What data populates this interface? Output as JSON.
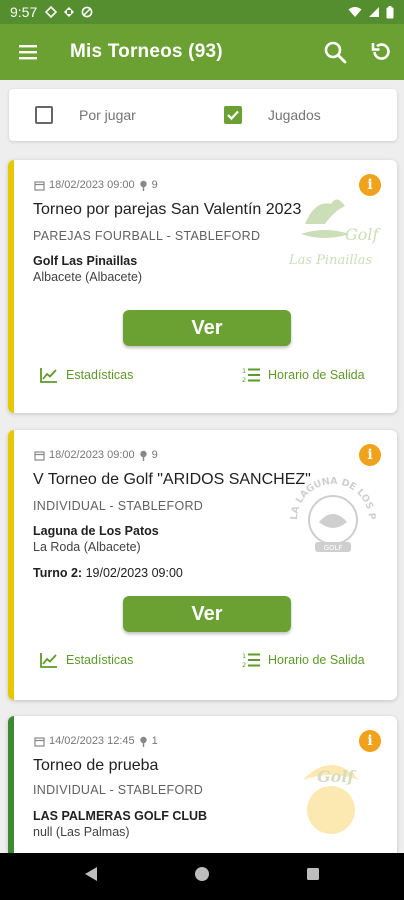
{
  "status_bar": {
    "time": "9:57"
  },
  "app_bar": {
    "title": "Mis Torneos (93)"
  },
  "filters": {
    "unplayed_label": "Por jugar",
    "played_label": "Jugados",
    "unplayed_checked": false,
    "played_checked": true
  },
  "tournaments": [
    {
      "datetime": "18/02/2023 09:00",
      "count": "9",
      "name": "Torneo por parejas San Valentín 2023",
      "mode": "PAREJAS FOURBALL - STABLEFORD",
      "club": "Golf Las Pinaillas",
      "location": "Albacete (Albacete)",
      "stripe_color": "#e6c800",
      "logo_text": [
        "Golf",
        "Las Pinaillas"
      ]
    },
    {
      "datetime": "18/02/2023 09:00",
      "count": "9",
      "name": "V Torneo de Golf \"ARIDOS SANCHEZ\"",
      "mode": "INDIVIDUAL - STABLEFORD",
      "club": "Laguna de Los Patos",
      "location": "La Roda (Albacete)",
      "turn_label": "Turno 2:",
      "turn_value": "19/02/2023 09:00",
      "stripe_color": "#e6c800",
      "logo_text": [
        "LA LAGUNA DE LOS PATOS",
        "GOLF"
      ]
    },
    {
      "datetime": "14/02/2023 12:45",
      "count": "1",
      "name": "Torneo de prueba",
      "mode": "INDIVIDUAL - STABLEFORD",
      "club": "LAS PALMERAS GOLF CLUB",
      "location": "null (Las Palmas)",
      "stripe_color": "#3c8a34",
      "logo_text": [
        "Golf"
      ]
    }
  ],
  "card_actions": {
    "view_label": "Ver",
    "stats_label": "Estadísticas",
    "schedule_label": "Horario de Salida",
    "info_glyph": "i"
  },
  "colors": {
    "primary": "#6aa132",
    "status_bar": "#548e2e",
    "info": "#f0a21b"
  }
}
